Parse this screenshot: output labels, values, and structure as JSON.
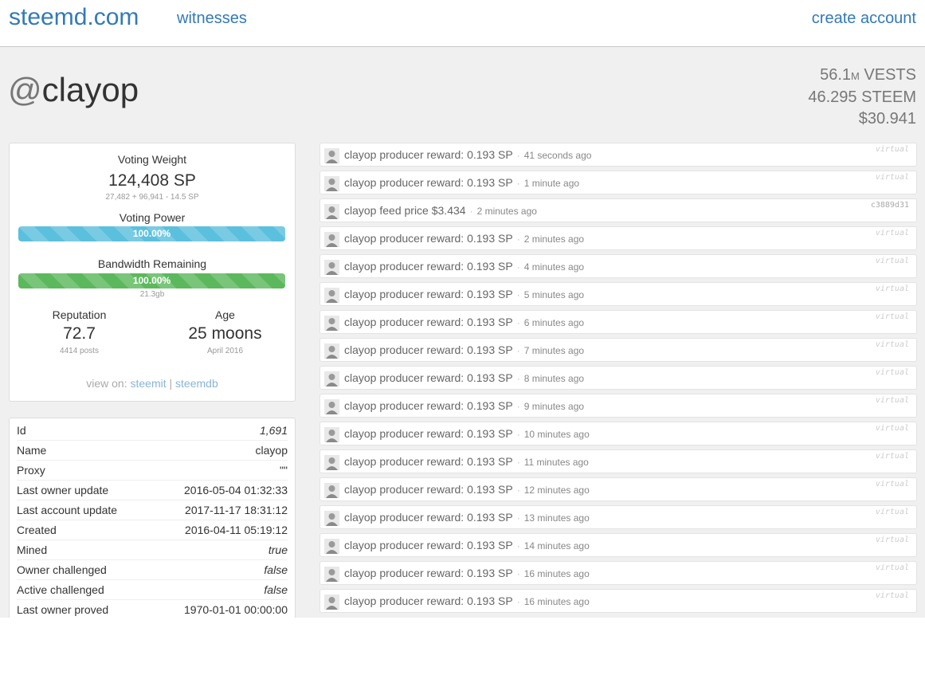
{
  "nav": {
    "brand": "steemd.com",
    "witnesses": "witnesses",
    "create_account": "create account"
  },
  "account": {
    "at": "@",
    "name": "clayop"
  },
  "balances": {
    "vests_num": "56.1",
    "vests_unit_small": "M",
    "vests_unit": " VESTS",
    "steem": "46.295 STEEM",
    "usd": "$30.941"
  },
  "card": {
    "voting_weight_label": "Voting Weight",
    "voting_weight_value": "124,408 SP",
    "voting_weight_sub": "27,482 + 96,941 - 14.5 SP",
    "voting_power_label": "Voting Power",
    "voting_power_text": "100.00%",
    "voting_power_fraction": 1.0,
    "bandwidth_label": "Bandwidth Remaining",
    "bandwidth_text": "100.00%",
    "bandwidth_fraction": 1.0,
    "bandwidth_sub": "21.3gb",
    "reputation_label": "Reputation",
    "reputation_value": "72.7",
    "reputation_sub": "4414 posts",
    "age_label": "Age",
    "age_value": "25 moons",
    "age_sub": "April 2016",
    "view_on_label": "view on:",
    "steemit_link": "steemit",
    "link_separator": "|",
    "steemdb_link": "steemdb"
  },
  "props": [
    {
      "key": "Id",
      "value": "1,691",
      "italic": true
    },
    {
      "key": "Name",
      "value": "clayop",
      "italic": false
    },
    {
      "key": "Proxy",
      "value": "\"\"",
      "italic": false
    },
    {
      "key": "Last owner update",
      "value": "2016-05-04 01:32:33",
      "italic": false
    },
    {
      "key": "Last account update",
      "value": "2017-11-17 18:31:12",
      "italic": false
    },
    {
      "key": "Created",
      "value": "2016-04-11 05:19:12",
      "italic": false
    },
    {
      "key": "Mined",
      "value": "true",
      "italic": true
    },
    {
      "key": "Owner challenged",
      "value": "false",
      "italic": true
    },
    {
      "key": "Active challenged",
      "value": "false",
      "italic": true
    },
    {
      "key": "Last owner proved",
      "value": "1970-01-01 00:00:00",
      "italic": false
    }
  ],
  "ops": [
    {
      "text": "clayop producer reward: 0.193 SP",
      "time": "41 seconds ago",
      "tag": "virtual",
      "tag_type": "virtual"
    },
    {
      "text": "clayop producer reward: 0.193 SP",
      "time": "1 minute ago",
      "tag": "virtual",
      "tag_type": "virtual"
    },
    {
      "text": "clayop feed price $3.434",
      "time": "2 minutes ago",
      "tag": "c3889d31",
      "tag_type": "hash"
    },
    {
      "text": "clayop producer reward: 0.193 SP",
      "time": "2 minutes ago",
      "tag": "virtual",
      "tag_type": "virtual"
    },
    {
      "text": "clayop producer reward: 0.193 SP",
      "time": "4 minutes ago",
      "tag": "virtual",
      "tag_type": "virtual"
    },
    {
      "text": "clayop producer reward: 0.193 SP",
      "time": "5 minutes ago",
      "tag": "virtual",
      "tag_type": "virtual"
    },
    {
      "text": "clayop producer reward: 0.193 SP",
      "time": "6 minutes ago",
      "tag": "virtual",
      "tag_type": "virtual"
    },
    {
      "text": "clayop producer reward: 0.193 SP",
      "time": "7 minutes ago",
      "tag": "virtual",
      "tag_type": "virtual"
    },
    {
      "text": "clayop producer reward: 0.193 SP",
      "time": "8 minutes ago",
      "tag": "virtual",
      "tag_type": "virtual"
    },
    {
      "text": "clayop producer reward: 0.193 SP",
      "time": "9 minutes ago",
      "tag": "virtual",
      "tag_type": "virtual"
    },
    {
      "text": "clayop producer reward: 0.193 SP",
      "time": "10 minutes ago",
      "tag": "virtual",
      "tag_type": "virtual"
    },
    {
      "text": "clayop producer reward: 0.193 SP",
      "time": "11 minutes ago",
      "tag": "virtual",
      "tag_type": "virtual"
    },
    {
      "text": "clayop producer reward: 0.193 SP",
      "time": "12 minutes ago",
      "tag": "virtual",
      "tag_type": "virtual"
    },
    {
      "text": "clayop producer reward: 0.193 SP",
      "time": "13 minutes ago",
      "tag": "virtual",
      "tag_type": "virtual"
    },
    {
      "text": "clayop producer reward: 0.193 SP",
      "time": "14 minutes ago",
      "tag": "virtual",
      "tag_type": "virtual"
    },
    {
      "text": "clayop producer reward: 0.193 SP",
      "time": "16 minutes ago",
      "tag": "virtual",
      "tag_type": "virtual"
    },
    {
      "text": "clayop producer reward: 0.193 SP",
      "time": "16 minutes ago",
      "tag": "virtual",
      "tag_type": "virtual"
    }
  ],
  "colors": {
    "link": "#337ab7",
    "voting_bar": "#5bc0de",
    "bandwidth_bar": "#5cb85c",
    "page_bg": "#f0f0f0"
  },
  "icons": {
    "op_avatar": "user-avatar-icon"
  }
}
